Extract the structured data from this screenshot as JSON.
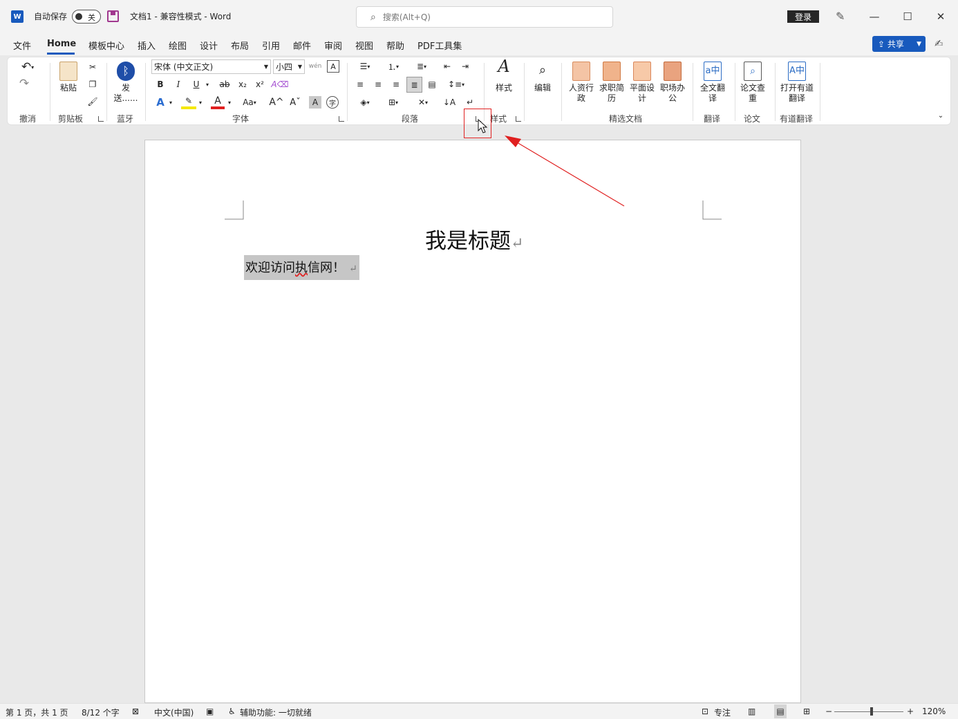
{
  "titlebar": {
    "app_icon": "W",
    "autosave_label": "自动保存",
    "autosave_state": "关",
    "doc_title": "文档1  -  兼容性模式  -  Word",
    "search_placeholder": "搜索(Alt+Q)",
    "login_label": "登录"
  },
  "menu": {
    "tabs": [
      "文件",
      "Home",
      "模板中心",
      "插入",
      "绘图",
      "设计",
      "布局",
      "引用",
      "邮件",
      "审阅",
      "视图",
      "帮助",
      "PDF工具集"
    ],
    "share_label": "共享"
  },
  "ribbon": {
    "groups": {
      "undo": "撤消",
      "clipboard": "剪贴板",
      "bluetooth": "蓝牙",
      "font": "字体",
      "paragraph": "段落",
      "styles": "样式",
      "jingxuan": "精选文档",
      "translate": "翻译",
      "paper": "论文",
      "youdao": "有道翻译"
    },
    "paste_label": "粘贴",
    "send_label": "发送......",
    "font_name": "宋体 (中文正文)",
    "font_size": "小四",
    "styles_label": "样式",
    "edit_label": "编辑",
    "hr_label": "人资行政",
    "resume_label": "求职简历",
    "design_label": "平面设计",
    "office_label": "职场办公",
    "fulltrans_label": "全文翻译",
    "papercheck_label": "论文查重",
    "open_youdao_label": "打开有道翻译",
    "font_buttons": {
      "bold": "B",
      "italic": "I",
      "underline": "U",
      "strike": "ab",
      "sub": "x₂",
      "sup": "x²",
      "case": "Aa",
      "grow": "A^",
      "shrink": "Aˇ",
      "shade": "A",
      "encircle": "字"
    }
  },
  "document": {
    "heading": "我是标题",
    "body_text_before": "欢迎访问",
    "body_text_squiggle": "执",
    "body_text_after": "信网！"
  },
  "status": {
    "page": "第 1 页，共 1 页",
    "words": "8/12 个字",
    "language": "中文(中国)",
    "accessibility": "辅助功能: 一切就绪",
    "focus": "专注",
    "zoom": "120%",
    "zoom_minus": "−",
    "zoom_plus": "+"
  },
  "colors": {
    "brand": "#185abd",
    "annotation": "#e02020"
  }
}
